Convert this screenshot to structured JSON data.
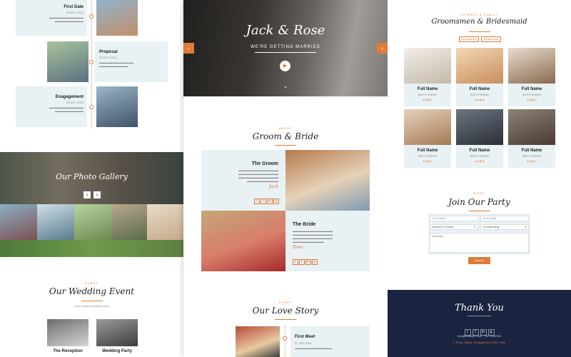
{
  "left": {
    "timeline": [
      {
        "title": "First Date",
        "date": "20 DEC 2015"
      },
      {
        "title": "Proposal",
        "date": "20 DEC 2015"
      },
      {
        "title": "Enagagement",
        "date": "20 DEC 2015"
      }
    ],
    "gallery": {
      "title": "Our Photo Gallery",
      "prev": "‹",
      "next": "›"
    },
    "event": {
      "tag": "EVENT",
      "title": "Our Wedding Event",
      "desc": "CALL about wedding event",
      "items": [
        "The Reception",
        "Wedding Party"
      ]
    }
  },
  "center": {
    "hero": {
      "names": "Jack & Rose",
      "subtitle": "WE'RE GETTING MARRIED",
      "play": "▶",
      "scroll": "⌄"
    },
    "about": {
      "tag": "ABOUT",
      "title": "Groom & Bride"
    },
    "groom": {
      "title": "The Groom",
      "signature": "Jack"
    },
    "bride": {
      "title": "The Bride",
      "signature": "Rose"
    },
    "story": {
      "tag": "STORY",
      "title": "Our Love Story",
      "item": {
        "title": "First Meet",
        "date": "21 JAN 2015"
      }
    }
  },
  "right": {
    "friends": {
      "tag": "FRIENDS & FAMILY",
      "title": "Groomsmen & Bridesmaid",
      "tabs": [
        "Groomsmen",
        "Bridesmaid"
      ],
      "people": [
        {
          "name": "Full Name",
          "role": "BEST FRIEND"
        },
        {
          "name": "Full Name",
          "role": "BEST FRIEND"
        },
        {
          "name": "Full Name",
          "role": "BEST FRIEND"
        },
        {
          "name": "Full Name",
          "role": "BEST FRIEND"
        },
        {
          "name": "Full Name",
          "role": "BEST FRIEND"
        },
        {
          "name": "Full Name",
          "role": "BEST FRIEND"
        }
      ]
    },
    "rsvp": {
      "tag": "RSVP",
      "title": "Join Our Party",
      "name_placeholder": "Your Name",
      "email_placeholder": "Your Email",
      "guests_value": "Number of Guest",
      "attending_value": "I'm Attending",
      "message_placeholder": "Message",
      "submit": "Submit"
    },
    "footer": {
      "title": "Thank You",
      "email": "info@example.com",
      "phone": "+00 0164788",
      "credit": "© Demo Name. Designed by HTML Code"
    }
  },
  "colors": {
    "accent": "#e07b39",
    "navy": "#1a2440",
    "card": "#e8f1f4"
  }
}
